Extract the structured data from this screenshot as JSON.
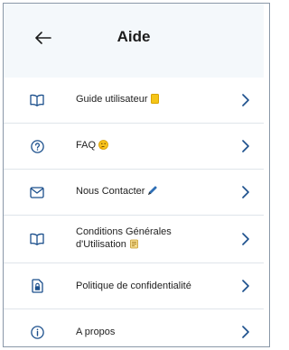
{
  "header": {
    "title": "Aide"
  },
  "items": [
    {
      "label": "Guide utilisateur",
      "icon": "book-icon",
      "emoji": "notebook-emoji"
    },
    {
      "label": "FAQ",
      "icon": "help-circle-icon",
      "emoji": "thinking-face-emoji"
    },
    {
      "label": "Nous Contacter",
      "icon": "mail-icon",
      "emoji": "pencil-emoji"
    },
    {
      "label": "Conditions Générales",
      "label2": "d'Utilisation",
      "icon": "book-icon",
      "emoji": "scroll-emoji"
    },
    {
      "label": "Politique de confidentialité",
      "icon": "lock-document-icon"
    },
    {
      "label": "A propos",
      "icon": "info-icon"
    }
  ],
  "colors": {
    "accent": "#1b4f8c",
    "background": "#f4f8fb",
    "divider": "#dfe5ea"
  }
}
